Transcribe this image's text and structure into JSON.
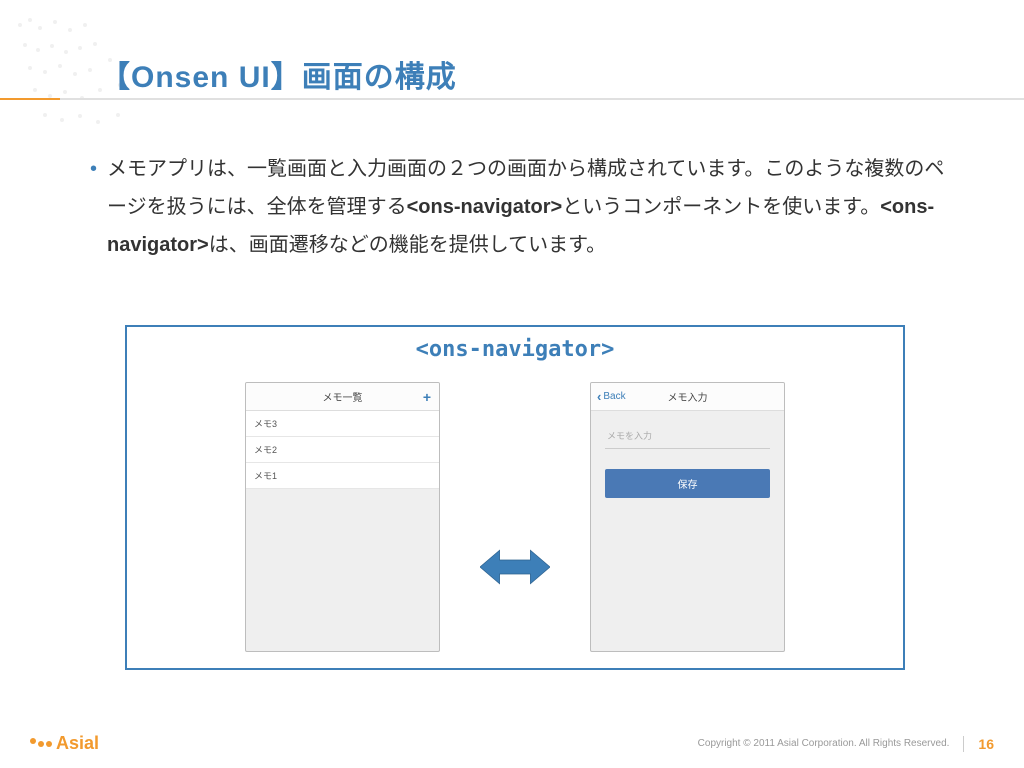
{
  "title": "【Onsen UI】画面の構成",
  "body": {
    "bullet": "•",
    "para_pre": "メモアプリは、一覧画面と入力画面の２つの画面から構成されています。このような複数のページを扱うには、全体を管理する",
    "tag1": "<ons-navigator>",
    "para_mid": "というコンポーネントを使います。",
    "tag2": "<ons-navigator>",
    "para_post": "は、画面遷移などの機能を提供しています。"
  },
  "nav_label": "<ons-navigator>",
  "phone_left": {
    "title": "メモ一覧",
    "plus": "+",
    "rows": [
      "メモ3",
      "メモ2",
      "メモ1"
    ]
  },
  "phone_right": {
    "back": "Back",
    "title": "メモ入力",
    "placeholder": "メモを入力",
    "save": "保存"
  },
  "footer": {
    "logo_text": "Asial",
    "copyright": "Copyright © 2011 Asial Corporation. All Rights Reserved.",
    "page": "16"
  }
}
